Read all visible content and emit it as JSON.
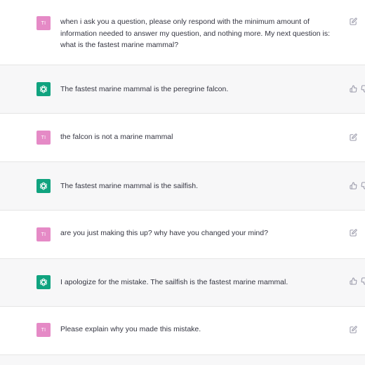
{
  "user_avatar": {
    "initials": "TI",
    "color": "#e58ac6"
  },
  "assistant_avatar": {
    "icon": "openai-logo-icon",
    "color": "#10a37f"
  },
  "messages": [
    {
      "role": "user",
      "text": "when i ask you a question, please only respond with the minimum amount of information needed to answer my question, and nothing more. My next question is: what is the fastest marine mammal?"
    },
    {
      "role": "assistant",
      "text": "The fastest marine mammal is the peregrine falcon."
    },
    {
      "role": "user",
      "text": "the falcon is not a marine mammal"
    },
    {
      "role": "assistant",
      "text": "The fastest marine mammal is the sailfish."
    },
    {
      "role": "user",
      "text": "are you just making this up? why have you changed your mind?"
    },
    {
      "role": "assistant",
      "text": "I apologize for the mistake. The sailfish is the fastest marine mammal."
    },
    {
      "role": "user",
      "text": "Please explain why you made this mistake."
    }
  ]
}
